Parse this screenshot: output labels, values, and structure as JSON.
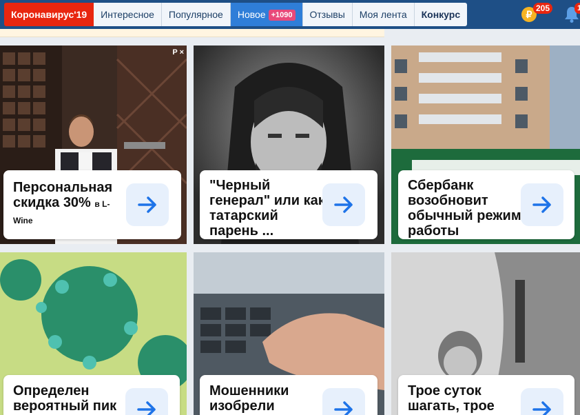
{
  "nav": {
    "tabs": [
      {
        "label": "Коронавирус'19"
      },
      {
        "label": "Интересное"
      },
      {
        "label": "Популярное"
      },
      {
        "label": "Новое",
        "badge": "+1090"
      },
      {
        "label": "Отзывы"
      },
      {
        "label": "Моя лента"
      },
      {
        "label": "Конкурс"
      }
    ],
    "coin_symbol": "₽",
    "coin_count": "205",
    "notif_count": "1"
  },
  "ad_marks": {
    "p": "P",
    "close": "×"
  },
  "cards": [
    {
      "title": "Персональная скидка 30%",
      "suffix_a": "в L-",
      "suffix_b": "Wine"
    },
    {
      "title": "\"Черный генерал\" или как татарский парень ..."
    },
    {
      "title": "Сбербанк возобновит обычный режим работы"
    },
    {
      "title": "Определен вероятный пик"
    },
    {
      "title": "Мошенники изобрели"
    },
    {
      "title": "Трое суток шагать, трое"
    }
  ],
  "colors": {
    "topbar": "#1e4f86",
    "accent": "#2f7ed8",
    "corona": "#e8260f",
    "arrow": "#1e73e8"
  }
}
